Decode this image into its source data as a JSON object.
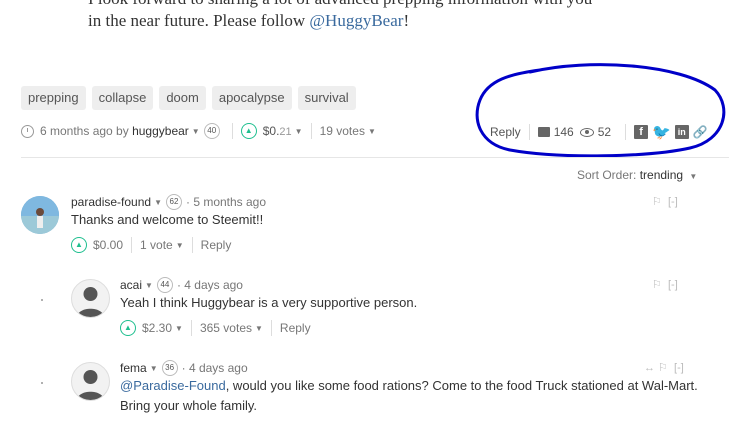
{
  "post": {
    "line1": "I look forward to sharing a lot of advanced prepping information with you",
    "line2_prefix": "in the near future. Please follow ",
    "line2_mention": "@HuggyBear",
    "line2_suffix": "!"
  },
  "tags": [
    "prepping",
    "collapse",
    "doom",
    "apocalypse",
    "survival"
  ],
  "meta": {
    "time": "6 months ago by",
    "author": "huggybear",
    "reputation": "40",
    "payout": "$0.",
    "payout_decimals": "21",
    "votes": "19 votes"
  },
  "actions": {
    "reply": "Reply",
    "comments_count": "146",
    "views_count": "52"
  },
  "sort": {
    "label": "Sort Order:",
    "value": "trending"
  },
  "comments": [
    {
      "author": "paradise-found",
      "reputation": "62",
      "time": "· 5 months ago",
      "body": "Thanks and welcome to Steemit!!",
      "payout": "$0.00",
      "votes": "1 vote",
      "reply": "Reply",
      "flag": "[-]"
    },
    {
      "author": "acai",
      "reputation": "44",
      "time": "· 4 days ago",
      "body": "Yeah I think Huggybear is a very supportive person.",
      "payout": "$2.30",
      "votes": "365 votes",
      "reply": "Reply",
      "flag": "[-]"
    },
    {
      "author": "fema",
      "reputation": "36",
      "time": "· 4 days ago",
      "body_mention": "@Paradise-Found",
      "body_line1": ", would you like some food rations? Come to the food Truck stationed at Wal-Mart.",
      "body_line2": "Bring your whole family.",
      "flag": "[-]"
    }
  ],
  "annotation": {
    "color": "#0000c8"
  }
}
